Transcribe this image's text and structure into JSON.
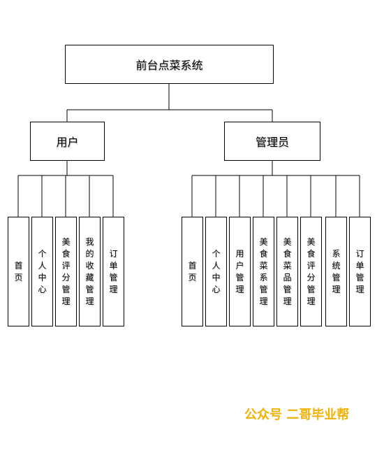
{
  "root": {
    "label": "前台点菜系统"
  },
  "branches": [
    {
      "label": "用户",
      "children": [
        "首页",
        "个人中心",
        "美食评分管理",
        "我的收藏管理",
        "订单管理"
      ]
    },
    {
      "label": "管理员",
      "children": [
        "首页",
        "个人中心",
        "用户管理",
        "美食菜系管理",
        "美食菜品管理",
        "美食评分管理",
        "系统管理",
        "订单管理"
      ]
    }
  ],
  "watermark": "公众号 二哥毕业帮",
  "colors": {
    "line": "#000000",
    "watermark": "#f2b100"
  }
}
